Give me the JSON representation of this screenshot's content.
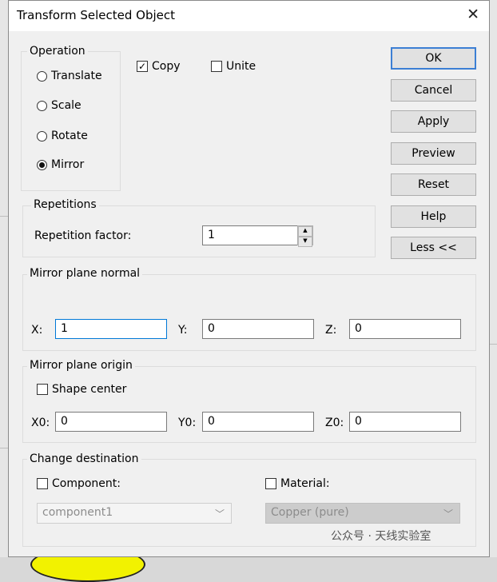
{
  "window": {
    "title": "Transform Selected Object",
    "close_glyph": "✕"
  },
  "operation": {
    "legend": "Operation",
    "options": [
      {
        "label": "Translate",
        "checked": false
      },
      {
        "label": "Scale",
        "checked": false
      },
      {
        "label": "Rotate",
        "checked": false
      },
      {
        "label": "Mirror",
        "checked": true
      }
    ]
  },
  "copy": {
    "label": "Copy",
    "checked": true
  },
  "unite": {
    "label": "Unite",
    "checked": false
  },
  "buttons": {
    "ok": "OK",
    "cancel": "Cancel",
    "apply": "Apply",
    "preview": "Preview",
    "reset": "Reset",
    "help": "Help",
    "less": "Less <<"
  },
  "repetitions": {
    "legend": "Repetitions",
    "factor_label": "Repetition factor:",
    "factor_value": "1"
  },
  "mirror_normal": {
    "legend": "Mirror plane normal",
    "x_label": "X:",
    "x_value": "1",
    "y_label": "Y:",
    "y_value": "0",
    "z_label": "Z:",
    "z_value": "0"
  },
  "mirror_origin": {
    "legend": "Mirror plane origin",
    "shape_center_label": "Shape center",
    "shape_center_checked": false,
    "x0_label": "X0:",
    "x0_value": "0",
    "y0_label": "Y0:",
    "y0_value": "0",
    "z0_label": "Z0:",
    "z0_value": "0"
  },
  "destination": {
    "legend": "Change destination",
    "component_label": "Component:",
    "component_checked": false,
    "component_value": "component1",
    "material_label": "Material:",
    "material_checked": false,
    "material_value": "Copper (pure)"
  },
  "watermark": {
    "text": "公众号 · 天线实验室"
  }
}
